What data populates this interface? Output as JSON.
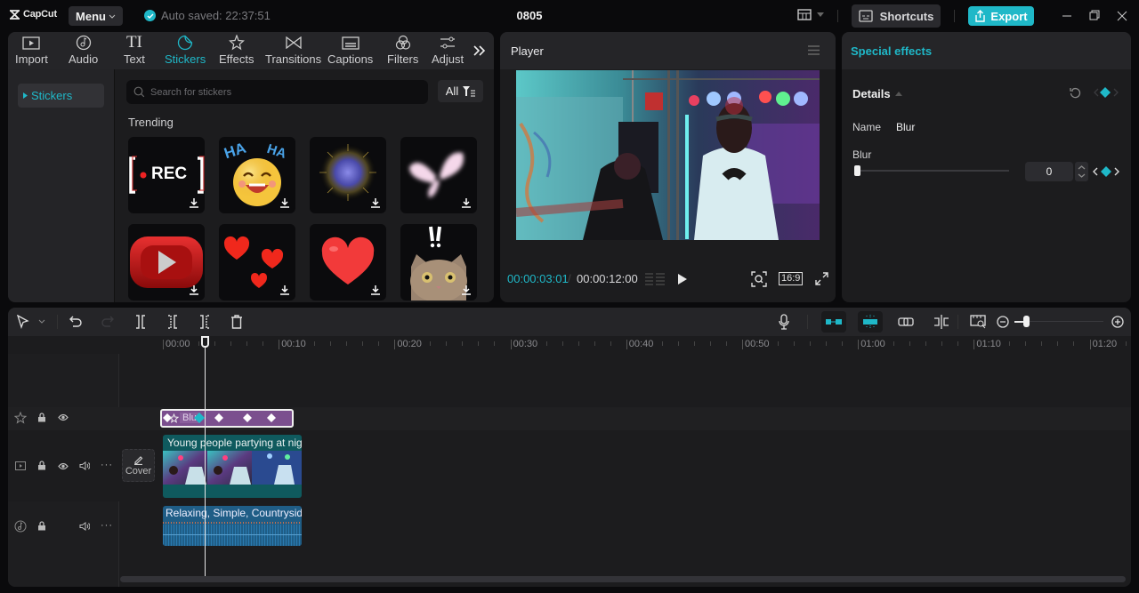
{
  "app": {
    "brand": "CapCut",
    "menu_label": "Menu",
    "autosave": "Auto saved: 22:37:51",
    "project_title": "0805",
    "shortcuts_label": "Shortcuts",
    "export_label": "Export"
  },
  "colors": {
    "accent": "#1fb8c8",
    "effect_clip": "#7b4f8e",
    "video_clip": "#0f5a5e",
    "audio_clip": "#1f5d86"
  },
  "media": {
    "tabs": [
      {
        "label": "Import",
        "icon": "import-icon"
      },
      {
        "label": "Audio",
        "icon": "audio-icon"
      },
      {
        "label": "Text",
        "icon": "text-icon"
      },
      {
        "label": "Stickers",
        "icon": "stickers-icon",
        "active": true
      },
      {
        "label": "Effects",
        "icon": "effects-icon"
      },
      {
        "label": "Transitions",
        "icon": "transitions-icon"
      },
      {
        "label": "Captions",
        "icon": "captions-icon"
      },
      {
        "label": "Filters",
        "icon": "filters-icon"
      },
      {
        "label": "Adjust",
        "icon": "adjust-icon"
      }
    ],
    "sidebar_item": "Stickers",
    "search_placeholder": "Search for stickers",
    "filter_label": "All",
    "section_title": "Trending",
    "stickers": [
      "REC",
      "HA HA laughing emoji",
      "fireworks",
      "glowing butterfly",
      "3D play button",
      "three hearts",
      "red heart",
      "surprised cat !!"
    ],
    "rec_text": "REC",
    "ha_text": "HA"
  },
  "player": {
    "title": "Player",
    "current_time": "00:00:03:01",
    "total_time": "00:00:12:00",
    "aspect": "16:9"
  },
  "properties": {
    "title": "Special effects",
    "section": "Details",
    "name_label": "Name",
    "name_value": "Blur",
    "blur_label": "Blur",
    "blur_value": "0",
    "blur_fraction": 0.0
  },
  "timeline": {
    "ruler": [
      "00:00",
      "00:10",
      "00:20",
      "00:30",
      "00:40",
      "00:50",
      "01:00",
      "01:10",
      "01:20"
    ],
    "playhead_time": "00:03",
    "zoom_fraction": 0.1,
    "effect_clip": {
      "label": "Blur",
      "keyframes": 5
    },
    "video_clip": {
      "label": "Young people partying at night"
    },
    "audio_clip": {
      "label": "Relaxing, Simple, Countryside"
    },
    "cover_label": "Cover"
  }
}
